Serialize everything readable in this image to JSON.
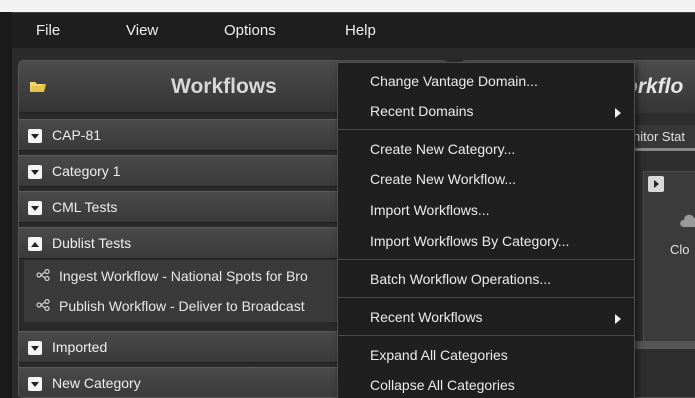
{
  "menubar": {
    "items": [
      "File",
      "View",
      "Options",
      "Help"
    ]
  },
  "workflows_panel": {
    "title": "Workflows",
    "categories": [
      {
        "label": "CAP-81",
        "state": "collapsed"
      },
      {
        "label": "Category 1",
        "state": "collapsed"
      },
      {
        "label": "CML Tests",
        "state": "collapsed"
      },
      {
        "label": "Dublist Tests",
        "state": "expanded"
      },
      {
        "label": "Imported",
        "state": "collapsed"
      },
      {
        "label": "New Category",
        "state": "collapsed"
      }
    ],
    "workflows": [
      "Ingest Workflow - National Spots for Bro",
      "Publish Workflow - Deliver to Broadcast"
    ]
  },
  "right_panel": {
    "title": "orkflo",
    "tab_label": "nitor Stat",
    "cloud_label": "Clo"
  },
  "context_menu": {
    "items": [
      {
        "label": "Change Vantage Domain...",
        "submenu": false
      },
      {
        "label": "Recent Domains",
        "submenu": true
      },
      {
        "label": "Create New Category...",
        "submenu": false
      },
      {
        "label": "Create New Workflow...",
        "submenu": false
      },
      {
        "label": "Import Workflows...",
        "submenu": false
      },
      {
        "label": "Import Workflows By Category...",
        "submenu": false
      },
      {
        "label": "Batch Workflow Operations...",
        "submenu": false
      },
      {
        "label": "Recent Workflows",
        "submenu": true
      },
      {
        "label": "Expand All Categories",
        "submenu": false
      },
      {
        "label": "Collapse All Categories",
        "submenu": false
      }
    ]
  },
  "colors": {
    "background": "#1a1a1a",
    "menu_background": "#1f1f1f",
    "text": "#ececec"
  }
}
